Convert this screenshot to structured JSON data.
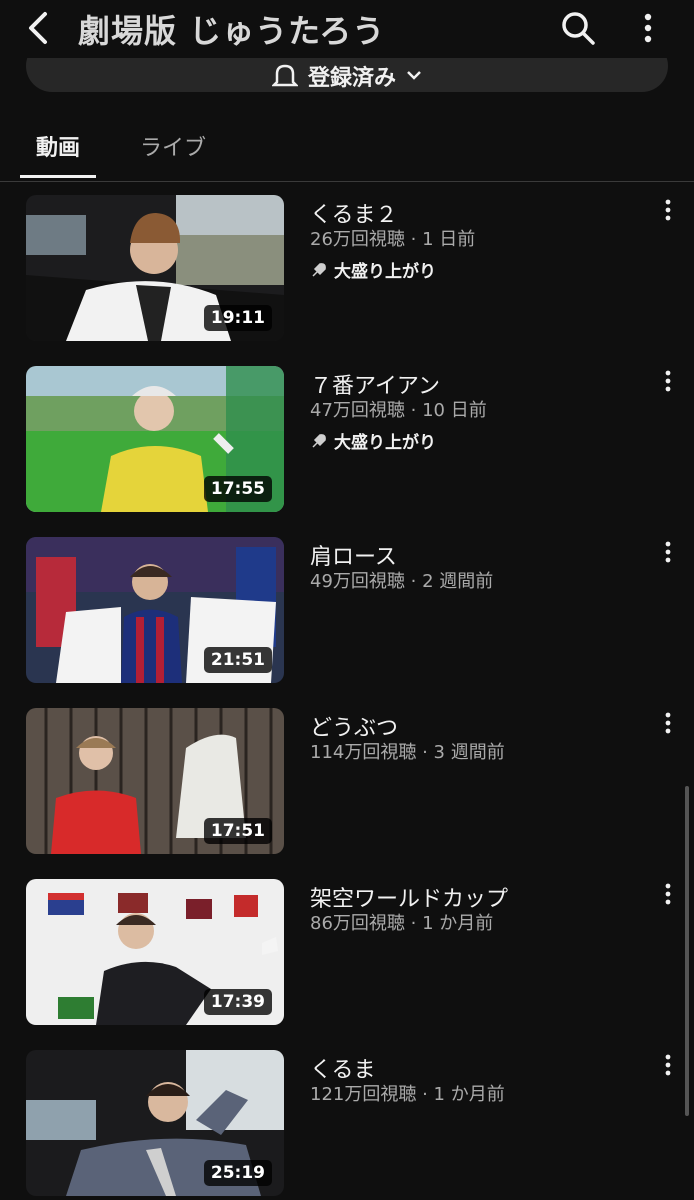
{
  "header": {
    "title": "劇場版 じゅうたろう"
  },
  "subscribe": {
    "label": "登録済み"
  },
  "tabs": [
    {
      "label": "動画"
    },
    {
      "label": "ライブ"
    }
  ],
  "videos": [
    {
      "title": "くるま２",
      "meta": "26万回視聴 · 1 日前",
      "badge": "大盛り上がり",
      "duration": "19:11"
    },
    {
      "title": "７番アイアン",
      "meta": "47万回視聴 · 10 日前",
      "badge": "大盛り上がり",
      "duration": "17:55"
    },
    {
      "title": "肩ロース",
      "meta": "49万回視聴 · 2 週間前",
      "badge": "",
      "duration": "21:51"
    },
    {
      "title": "どうぶつ",
      "meta": "114万回視聴 · 3 週間前",
      "badge": "",
      "duration": "17:51"
    },
    {
      "title": "架空ワールドカップ",
      "meta": "86万回視聴 · 1 か月前",
      "badge": "",
      "duration": "17:39"
    },
    {
      "title": "くるま",
      "meta": "121万回視聴 · 1 か月前",
      "badge": "",
      "duration": "25:19"
    }
  ],
  "colors": {
    "background": "#0f0f0f",
    "text": "#f1f1f1",
    "secondary": "#aaaaaa",
    "pill": "#272727"
  }
}
